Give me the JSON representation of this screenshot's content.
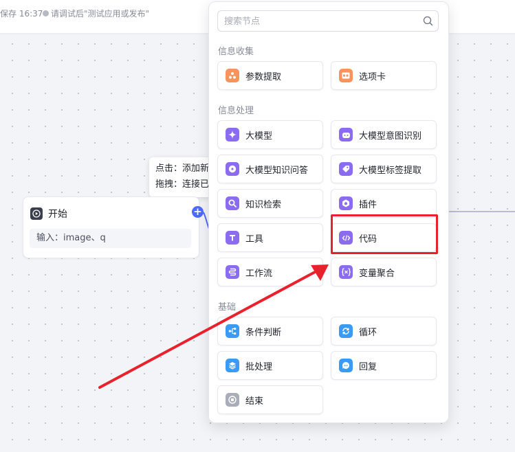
{
  "topbar": {
    "saved_text": "保存 16:37",
    "hint_text": "请调试后\"测试应用或发布\""
  },
  "tooltip": {
    "line1": "点击：添加新",
    "line2": "拖拽：连接已"
  },
  "start_node": {
    "title": "开始",
    "params": "输入：image、q",
    "add_symbol": "+"
  },
  "panel": {
    "search_placeholder": "搜索节点",
    "sections": [
      {
        "title": "信息收集",
        "items": [
          {
            "label": "参数提取",
            "icon": "parameter-extract-icon",
            "color": "#f7935d"
          },
          {
            "label": "选项卡",
            "icon": "option-card-icon",
            "color": "#f7935d"
          }
        ]
      },
      {
        "title": "信息处理",
        "items": [
          {
            "label": "大模型",
            "icon": "sparkle-icon",
            "color": "#8b6cf0"
          },
          {
            "label": "大模型意图识别",
            "icon": "robot-icon",
            "color": "#8b6cf0"
          },
          {
            "label": "大模型知识问答",
            "icon": "knowledge-qa-icon",
            "color": "#8b6cf0"
          },
          {
            "label": "大模型标签提取",
            "icon": "tag-icon",
            "color": "#8b6cf0"
          },
          {
            "label": "知识检索",
            "icon": "search-icon",
            "color": "#8b6cf0"
          },
          {
            "label": "插件",
            "icon": "plugin-icon",
            "color": "#8b6cf0"
          },
          {
            "label": "工具",
            "icon": "tool-icon",
            "color": "#8b6cf0"
          },
          {
            "label": "代码",
            "icon": "code-icon",
            "color": "#8b6cf0"
          },
          {
            "label": "工作流",
            "icon": "workflow-icon",
            "color": "#8b6cf0"
          },
          {
            "label": "变量聚合",
            "icon": "variable-aggregate-icon",
            "color": "#8b6cf0"
          }
        ]
      },
      {
        "title": "基础",
        "items": [
          {
            "label": "条件判断",
            "icon": "branch-icon",
            "color": "#3b9af5"
          },
          {
            "label": "循环",
            "icon": "loop-icon",
            "color": "#3b9af5"
          },
          {
            "label": "批处理",
            "icon": "layers-icon",
            "color": "#3b9af5"
          },
          {
            "label": "回复",
            "icon": "reply-icon",
            "color": "#3b9af5"
          },
          {
            "label": "结束",
            "icon": "stop-icon",
            "color": "#a9adb8"
          }
        ]
      }
    ]
  },
  "annotation": {
    "highlight_color": "#e8222c"
  }
}
